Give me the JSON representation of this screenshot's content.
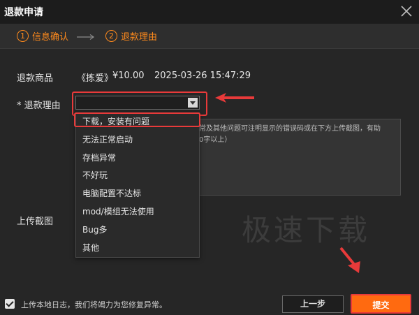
{
  "window": {
    "title": "退款申请"
  },
  "steps": [
    {
      "num": "1",
      "label": "信息确认"
    },
    {
      "num": "2",
      "label": "退款理由"
    }
  ],
  "product": {
    "label": "退款商品",
    "name": "《拣爱》",
    "price": "¥10.00",
    "datetime": "2025-03-26 15:47:29"
  },
  "reason": {
    "label": "* 退款理由",
    "selected": "",
    "options": [
      "下载，安装有问题",
      "无法正常启动",
      "存档异常",
      "不好玩",
      "电脑配置不达标",
      "mod/模组无法使用",
      "Bug多",
      "其他"
    ]
  },
  "description": {
    "visible_text_line1": "常及其他问题可注明显示的错误码或在下方上传截图，有助",
    "visible_text_line2": "0字以上）"
  },
  "upload": {
    "label": "上传截图"
  },
  "watermark": "极速下载",
  "footer": {
    "log_checkbox_checked": true,
    "log_text": "上传本地日志，我们将竭力为您修复异常。",
    "prev_label": "上一步",
    "submit_label": "提交"
  },
  "colors": {
    "accent": "#ff8a1c",
    "submit": "#ff6a10",
    "annotation": "#e83a3a"
  }
}
